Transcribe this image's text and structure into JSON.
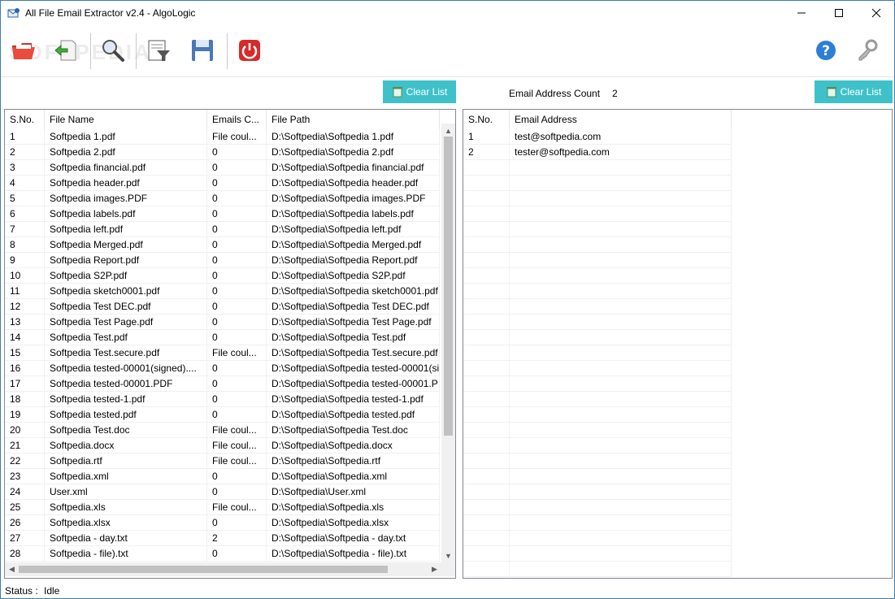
{
  "window": {
    "title": "All File Email Extractor v2.4 - AlgoLogic"
  },
  "toolbar": {
    "watermark": "SOFTPEDIA"
  },
  "left_panel": {
    "clear_label": "Clear List",
    "columns": [
      "S.No.",
      "File Name",
      "Emails C...",
      "File Path"
    ],
    "rows": [
      [
        "1",
        "Softpedia 1.pdf",
        "File coul...",
        "D:\\Softpedia\\Softpedia 1.pdf"
      ],
      [
        "2",
        "Softpedia 2.pdf",
        "0",
        "D:\\Softpedia\\Softpedia 2.pdf"
      ],
      [
        "3",
        "Softpedia financial.pdf",
        "0",
        "D:\\Softpedia\\Softpedia financial.pdf"
      ],
      [
        "4",
        "Softpedia header.pdf",
        "0",
        "D:\\Softpedia\\Softpedia header.pdf"
      ],
      [
        "5",
        "Softpedia images.PDF",
        "0",
        "D:\\Softpedia\\Softpedia images.PDF"
      ],
      [
        "6",
        "Softpedia labels.pdf",
        "0",
        "D:\\Softpedia\\Softpedia labels.pdf"
      ],
      [
        "7",
        "Softpedia left.pdf",
        "0",
        "D:\\Softpedia\\Softpedia left.pdf"
      ],
      [
        "8",
        "Softpedia Merged.pdf",
        "0",
        "D:\\Softpedia\\Softpedia Merged.pdf"
      ],
      [
        "9",
        "Softpedia Report.pdf",
        "0",
        "D:\\Softpedia\\Softpedia Report.pdf"
      ],
      [
        "10",
        "Softpedia S2P.pdf",
        "0",
        "D:\\Softpedia\\Softpedia S2P.pdf"
      ],
      [
        "11",
        "Softpedia sketch0001.pdf",
        "0",
        "D:\\Softpedia\\Softpedia sketch0001.pdf"
      ],
      [
        "12",
        "Softpedia Test DEC.pdf",
        "0",
        "D:\\Softpedia\\Softpedia Test DEC.pdf"
      ],
      [
        "13",
        "Softpedia Test Page.pdf",
        "0",
        "D:\\Softpedia\\Softpedia Test Page.pdf"
      ],
      [
        "14",
        "Softpedia Test.pdf",
        "0",
        "D:\\Softpedia\\Softpedia Test.pdf"
      ],
      [
        "15",
        "Softpedia Test.secure.pdf",
        "File coul...",
        "D:\\Softpedia\\Softpedia Test.secure.pdf"
      ],
      [
        "16",
        "Softpedia tested-00001(signed)....",
        "0",
        "D:\\Softpedia\\Softpedia tested-00001(si"
      ],
      [
        "17",
        "Softpedia tested-00001.PDF",
        "0",
        "D:\\Softpedia\\Softpedia tested-00001.P"
      ],
      [
        "18",
        "Softpedia tested-1.pdf",
        "0",
        "D:\\Softpedia\\Softpedia tested-1.pdf"
      ],
      [
        "19",
        "Softpedia tested.pdf",
        "0",
        "D:\\Softpedia\\Softpedia tested.pdf"
      ],
      [
        "20",
        "Softpedia Test.doc",
        "File coul...",
        "D:\\Softpedia\\Softpedia Test.doc"
      ],
      [
        "21",
        "Softpedia.docx",
        "File coul...",
        "D:\\Softpedia\\Softpedia.docx"
      ],
      [
        "22",
        "Softpedia.rtf",
        "File coul...",
        "D:\\Softpedia\\Softpedia.rtf"
      ],
      [
        "23",
        "Softpedia.xml",
        "0",
        "D:\\Softpedia\\Softpedia.xml"
      ],
      [
        "24",
        "User.xml",
        "0",
        "D:\\Softpedia\\User.xml"
      ],
      [
        "25",
        "Softpedia.xls",
        "File coul...",
        "D:\\Softpedia\\Softpedia.xls"
      ],
      [
        "26",
        "Softpedia.xlsx",
        "0",
        "D:\\Softpedia\\Softpedia.xlsx"
      ],
      [
        "27",
        "Softpedia - day.txt",
        "2",
        "D:\\Softpedia\\Softpedia - day.txt"
      ],
      [
        "28",
        "Softpedia - file).txt",
        "0",
        "D:\\Softpedia\\Softpedia - file).txt"
      ]
    ]
  },
  "right_panel": {
    "count_label": "Email Address Count",
    "count_value": "2",
    "clear_label": "Clear List",
    "columns": [
      "S.No.",
      "Email Address"
    ],
    "rows": [
      [
        "1",
        "test@softpedia.com"
      ],
      [
        "2",
        "tester@softpedia.com"
      ]
    ],
    "empty_rows": 27
  },
  "status": {
    "label": "Status :",
    "value": "Idle"
  },
  "colors": {
    "accent": "#3fc1c9",
    "border": "#828790",
    "scroll_thumb": "#c1c1c1"
  }
}
